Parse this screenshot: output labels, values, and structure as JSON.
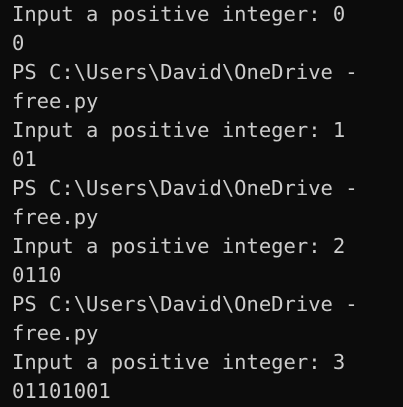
{
  "terminal": {
    "lines": [
      "Input a positive integer: 0",
      "0",
      "PS C:\\Users\\David\\OneDrive -",
      "free.py",
      "Input a positive integer: 1",
      "01",
      "PS C:\\Users\\David\\OneDrive -",
      "free.py",
      "Input a positive integer: 2",
      "0110",
      "PS C:\\Users\\David\\OneDrive -",
      "free.py",
      "Input a positive integer: 3",
      "01101001"
    ]
  }
}
